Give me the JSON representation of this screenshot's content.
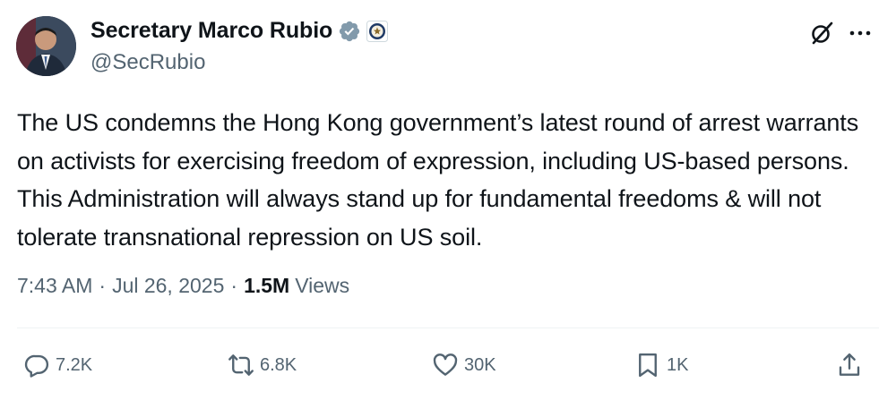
{
  "author": {
    "display_name": "Secretary Marco Rubio",
    "handle": "@SecRubio",
    "verified_badge_color": "#829aab"
  },
  "tweet": {
    "text": "The US condemns the Hong Kong government’s latest round of arrest warrants on activists for exercising freedom of expression, including US-based persons. This Administration will always stand up for fundamental freedoms & will not tolerate transnational repression on US soil."
  },
  "meta": {
    "time": "7:43 AM",
    "date": "Jul 26, 2025",
    "separator": "·",
    "views_count": "1.5M",
    "views_label": "Views"
  },
  "actions": {
    "replies": "7.2K",
    "reposts": "6.8K",
    "likes": "30K",
    "bookmarks": "1K"
  },
  "icons": {
    "grok": "grok-icon",
    "more": "more-icon",
    "reply": "reply-icon",
    "repost": "repost-icon",
    "like": "heart-icon",
    "bookmark": "bookmark-icon",
    "share": "share-icon"
  },
  "colors": {
    "text_primary": "#0f1419",
    "text_secondary": "#536471",
    "divider": "#eff3f4"
  }
}
